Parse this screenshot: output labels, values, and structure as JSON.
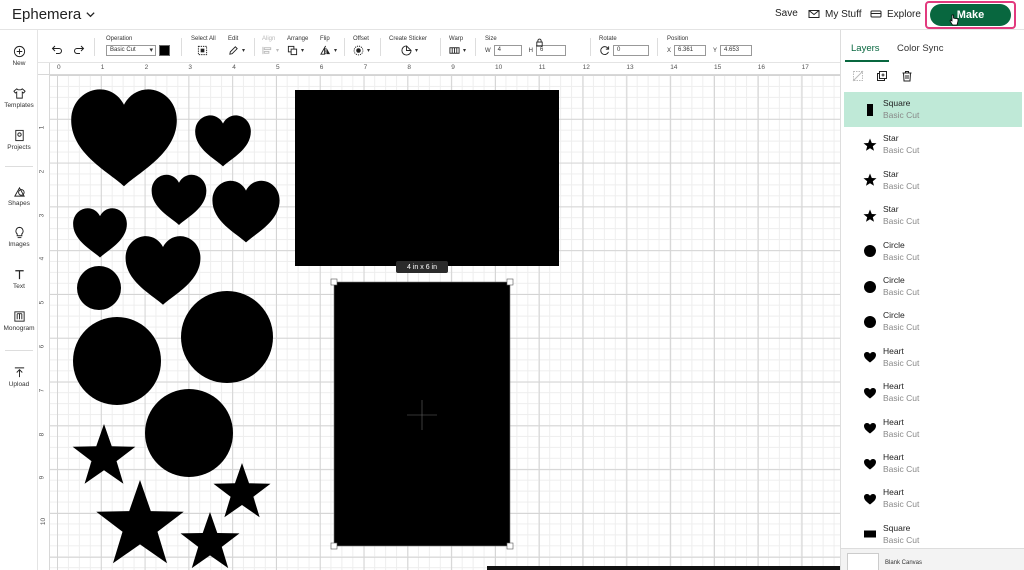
{
  "header": {
    "project_title": "Ephemera",
    "save_label": "Save",
    "mystuff_label": "My Stuff",
    "explore_label": "Explore",
    "make_label": "Make",
    "accent_color": "#08673f",
    "highlight_color": "#e23a7e"
  },
  "rail": {
    "items": [
      {
        "label": "New",
        "icon": "plus-circle-icon"
      },
      {
        "label": "Templates",
        "icon": "shirt-icon"
      },
      {
        "label": "Projects",
        "icon": "projects-icon"
      },
      {
        "label": "Shapes",
        "icon": "shapes-icon"
      },
      {
        "label": "Images",
        "icon": "bulb-icon"
      },
      {
        "label": "Text",
        "icon": "text-icon"
      },
      {
        "label": "Monogram",
        "icon": "monogram-icon"
      },
      {
        "label": "Upload",
        "icon": "upload-icon"
      }
    ]
  },
  "toolbar": {
    "operation_label": "Operation",
    "operation_value": "Basic Cut",
    "select_all_label": "Select All",
    "edit_label": "Edit",
    "align_label": "Align",
    "arrange_label": "Arrange",
    "flip_label": "Flip",
    "offset_label": "Offset",
    "create_sticker_label": "Create Sticker",
    "warp_label": "Warp",
    "size_label": "Size",
    "w_label": "W",
    "w_value": "4",
    "h_label": "H",
    "h_value": "6",
    "rotate_label": "Rotate",
    "rotate_value": "0",
    "position_label": "Position",
    "x_label": "X",
    "x_value": "6.361",
    "y_label": "Y",
    "y_value": "4.653"
  },
  "rulers": {
    "top": [
      "0",
      "1",
      "2",
      "3",
      "4",
      "5",
      "6",
      "7",
      "8",
      "9",
      "10",
      "11",
      "12",
      "13",
      "14",
      "15",
      "16",
      "17"
    ],
    "left": [
      "1",
      "2",
      "3",
      "4",
      "5",
      "6",
      "7",
      "8",
      "9",
      "10"
    ]
  },
  "canvas": {
    "size_tag": "4  in x 6  in"
  },
  "panel": {
    "tab_layers": "Layers",
    "tab_color_sync": "Color Sync",
    "layers": [
      {
        "name": "Square",
        "op": "Basic Cut",
        "shape": "tall-rect",
        "selected": true
      },
      {
        "name": "Star",
        "op": "Basic Cut",
        "shape": "star"
      },
      {
        "name": "Star",
        "op": "Basic Cut",
        "shape": "star"
      },
      {
        "name": "Star",
        "op": "Basic Cut",
        "shape": "star"
      },
      {
        "name": "Circle",
        "op": "Basic Cut",
        "shape": "circle"
      },
      {
        "name": "Circle",
        "op": "Basic Cut",
        "shape": "circle"
      },
      {
        "name": "Circle",
        "op": "Basic Cut",
        "shape": "circle"
      },
      {
        "name": "Heart",
        "op": "Basic Cut",
        "shape": "heart"
      },
      {
        "name": "Heart",
        "op": "Basic Cut",
        "shape": "heart"
      },
      {
        "name": "Heart",
        "op": "Basic Cut",
        "shape": "heart"
      },
      {
        "name": "Heart",
        "op": "Basic Cut",
        "shape": "heart"
      },
      {
        "name": "Heart",
        "op": "Basic Cut",
        "shape": "heart"
      },
      {
        "name": "Square",
        "op": "Basic Cut",
        "shape": "wide-rect"
      }
    ],
    "blank_canvas_label": "Blank Canvas"
  }
}
